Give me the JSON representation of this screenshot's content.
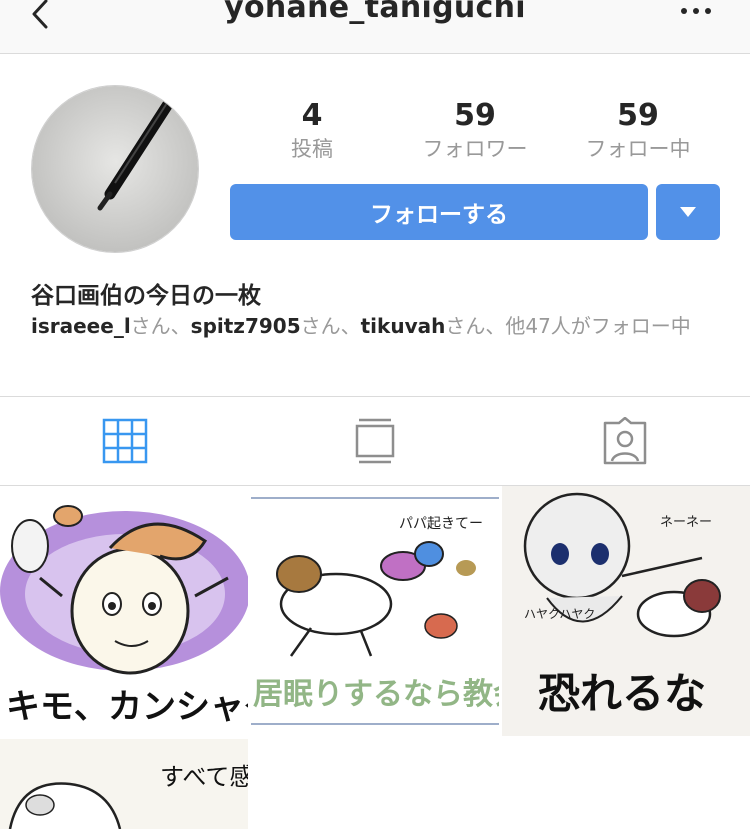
{
  "header": {
    "username": "yohane_taniguchi"
  },
  "profile": {
    "stats": [
      {
        "value": "4",
        "label": "投稿"
      },
      {
        "value": "59",
        "label": "フォロワー"
      },
      {
        "value": "59",
        "label": "フォロー中"
      }
    ],
    "follow_label": "フォローする",
    "display_name": "谷口画伯の今日の一枚",
    "followed_by": {
      "user1": "israeee_l",
      "user2": "spitz7905",
      "user3": "tikuvah",
      "san": "さん、",
      "others": "他47人がフォロー中"
    }
  },
  "posts": [
    {
      "caption": "キモ、カンシャダヨネ"
    },
    {
      "caption_top": "パパ起きてー",
      "caption": "居眠りするなら教会で"
    },
    {
      "caption_top": "ネーネー",
      "caption_side": "ハヤクハヤク",
      "caption": "恐れるな"
    },
    {
      "caption": "すべて感じて"
    }
  ],
  "colors": {
    "accent": "#5291e8",
    "muted_text": "#999999",
    "active_tab": "#3897f0"
  }
}
